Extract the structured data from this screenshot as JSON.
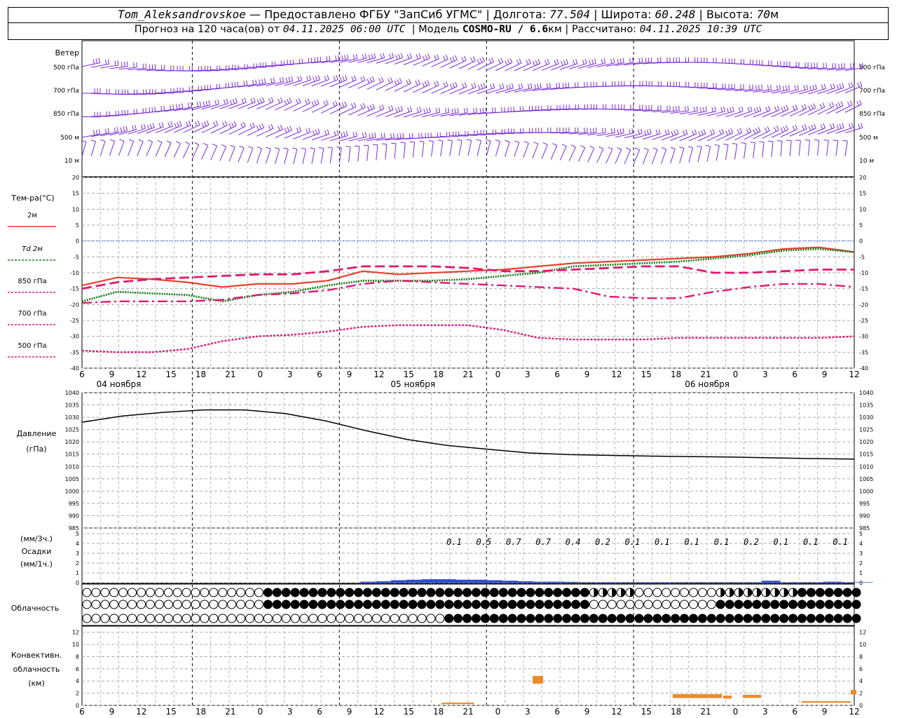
{
  "header": {
    "station": "Tom_Aleksandrovskoe",
    "provided": "— Предоставлено ФГБУ \"ЗапСиб УГМС\"",
    "lon_label": "Долгота:",
    "lon": "77.504",
    "lat_label": "Широта:",
    "lat": "60.248",
    "alt_label": "Высота:",
    "alt": "70",
    "alt_unit": "м",
    "forecast_label": "Прогноз на 120 часа(ов) от",
    "forecast_start": "04.11.2025 06:00 UTC",
    "model_label": "Модель",
    "model": "COSMO-RU / 6.6",
    "model_unit": "км",
    "calc_label": "Рассчитано:",
    "calc_time": "04.11.2025 10:39 UTC"
  },
  "labels": {
    "wind": "Ветер",
    "wind_levels": [
      "500 гПа",
      "700 гПа",
      "850 гПа",
      "500 м",
      "10 м"
    ],
    "temp_title": "Тем-ра(°C)",
    "legend": [
      {
        "name": "2м",
        "color": "#e8412f",
        "style": "solid"
      },
      {
        "name": "Td 2м",
        "color": "#1a7a1a",
        "style": "dotted"
      },
      {
        "name": "850 гПа",
        "color": "#e01a70",
        "style": "dash"
      },
      {
        "name": "700 гПа",
        "color": "#e01a70",
        "style": "dashdot"
      },
      {
        "name": "500 гПа",
        "color": "#e01a70",
        "style": "dot"
      }
    ],
    "days": [
      "04 ноября",
      "05 ноября",
      "06 ноября"
    ],
    "pressure_title": "Давление",
    "pressure_unit": "(гПа)",
    "precip_unit_top": "(мм/3ч.)",
    "precip_title": "Осадки",
    "precip_unit_bottom": "(мм/1ч.)",
    "cloud_title": "Облачность",
    "conv_title_1": "Конвективн.",
    "conv_title_2": "облачность",
    "conv_unit": "(км)"
  },
  "chart_data": [
    {
      "type": "line",
      "title": "Тем-ра(°C)",
      "x_ticks": [
        "6",
        "9",
        "12",
        "15",
        "18",
        "21",
        "0",
        "3",
        "6",
        "9",
        "12",
        "15",
        "18",
        "21",
        "0",
        "3",
        "6",
        "9",
        "12",
        "15",
        "18",
        "21",
        "0",
        "3",
        "6",
        "9",
        "12"
      ],
      "ylim": [
        -40,
        20
      ],
      "y_ticks": [
        20,
        15,
        10,
        5,
        0,
        -5,
        -10,
        -15,
        -20,
        -25,
        -30,
        -35,
        -40
      ],
      "x_hours": [
        0,
        3,
        6,
        9,
        12,
        15,
        18,
        21,
        24,
        27,
        30,
        33,
        36,
        39,
        42,
        45,
        48,
        51,
        54,
        57,
        60,
        63,
        66,
        69,
        72,
        75,
        78
      ],
      "series": [
        {
          "name": "2м",
          "values": [
            -14,
            -11.5,
            -12,
            -13,
            -14.5,
            -13.5,
            -13.5,
            -12.5,
            -9.5,
            -10.5,
            -10,
            -9.5,
            -9,
            -8,
            -7,
            -6.5,
            -6,
            -5.5,
            -5,
            -4,
            -2.5,
            -2,
            -3.5
          ]
        },
        {
          "name": "Td 2м",
          "values": [
            -19,
            -16,
            -16.5,
            -17,
            -19,
            -17,
            -16,
            -14,
            -12.5,
            -12.5,
            -12.5,
            -12,
            -11,
            -10,
            -8,
            -7.5,
            -7,
            -6.5,
            -5.5,
            -4.5,
            -3,
            -2.5,
            -3.5
          ]
        },
        {
          "name": "850 гПа",
          "values": [
            -15,
            -13,
            -12,
            -11.5,
            -11,
            -10.5,
            -10.5,
            -9.5,
            -8,
            -8,
            -8,
            -8.5,
            -9.5,
            -9.5,
            -9,
            -8.5,
            -8,
            -8,
            -10,
            -10,
            -9.5,
            -9,
            -9
          ]
        },
        {
          "name": "700 гПа",
          "values": [
            -19.5,
            -19,
            -19,
            -19,
            -18.5,
            -17,
            -16.5,
            -15.5,
            -13.5,
            -12.5,
            -13,
            -13.5,
            -14,
            -14.5,
            -15,
            -17.5,
            -18,
            -18,
            -16,
            -14.5,
            -13.5,
            -13.5,
            -14.5
          ]
        },
        {
          "name": "500 гПа",
          "values": [
            -34.5,
            -35,
            -35,
            -34,
            -31.5,
            -30,
            -29.5,
            -28.5,
            -27,
            -26.5,
            -26.5,
            -26.5,
            -28,
            -30.5,
            -31,
            -31,
            -31,
            -30.5,
            -30.5,
            -30.5,
            -30.5,
            -30.5,
            -30
          ]
        }
      ]
    },
    {
      "type": "line",
      "title": "Давление",
      "ylim": [
        985,
        1040
      ],
      "y_ticks": [
        1040,
        1035,
        1030,
        1025,
        1020,
        1015,
        1010,
        1005,
        1000,
        995,
        990,
        985
      ],
      "series": [
        {
          "name": "Давление",
          "values": [
            1028,
            1030.5,
            1032,
            1033,
            1033,
            1031.5,
            1028.5,
            1024.5,
            1021,
            1018.5,
            1017,
            1015.5,
            1014.8,
            1014.5,
            1014.2,
            1014,
            1013.8,
            1013.5,
            1013.2,
            1013
          ]
        }
      ]
    },
    {
      "type": "bar",
      "title": "Осадки",
      "ylim": [
        0,
        5
      ],
      "y_ticks": [
        5,
        4,
        3,
        2,
        1,
        0
      ],
      "labels_3h": [
        "0.1",
        "0.5",
        "0.7",
        "0.7",
        "0.4",
        "0.2",
        "0.1",
        "0.1",
        "0.1",
        "0.1",
        "0.2",
        "0.1",
        "0.1",
        "0.1"
      ],
      "bars_hours": [
        54,
        57,
        60,
        63,
        66,
        69,
        72,
        75,
        78,
        81,
        84,
        87,
        90,
        93,
        96,
        99,
        102,
        105,
        108,
        111,
        114,
        117,
        120,
        123,
        126,
        129,
        132,
        135,
        138,
        141,
        144,
        147,
        150
      ],
      "bars_values": [
        0.1,
        0.15,
        0.25,
        0.3,
        0.35,
        0.35,
        0.3,
        0.3,
        0.25,
        0.2,
        0.15,
        0.1,
        0.1,
        0.08,
        0.05,
        0.05,
        0.05,
        0.05,
        0.05,
        0.05,
        0.05,
        0.05,
        0.05,
        0.05,
        0.05,
        0.05,
        0.2,
        0.05,
        0.05,
        0.05,
        0.1,
        0.05,
        0.05
      ]
    },
    {
      "type": "bar",
      "title": "Конвективн. облачность",
      "ylim": [
        0,
        13
      ],
      "y_ticks": [
        12,
        10,
        8,
        6,
        4,
        2,
        0
      ]
    }
  ]
}
